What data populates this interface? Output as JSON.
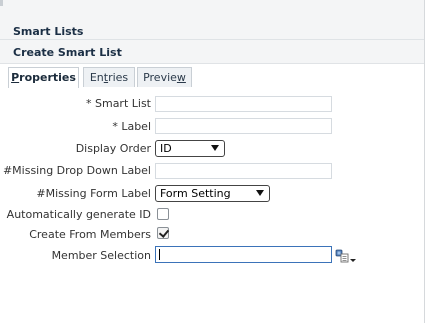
{
  "header": {
    "title": "Smart Lists",
    "subtitle": "Create Smart List"
  },
  "tabs": [
    {
      "label_prefix": "",
      "label_underline": "P",
      "label_rest": "roperties",
      "active": true
    },
    {
      "label_prefix": "En",
      "label_underline": "t",
      "label_rest": "ries",
      "active": false
    },
    {
      "label_prefix": "Previe",
      "label_underline": "w",
      "label_rest": "",
      "active": false
    }
  ],
  "form": {
    "smart_list_label": "* Smart List",
    "label_label": "* Label",
    "display_order_label": "Display Order",
    "display_order_value": "ID",
    "missing_drop_down_label": "#Missing Drop Down Label",
    "missing_form_label": "#Missing Form Label",
    "missing_form_value": "Form Setting",
    "auto_generate_label": "Automatically generate ID",
    "auto_generate_checked": false,
    "create_from_members_label": "Create From Members",
    "create_from_members_checked": true,
    "member_selection_label": "Member Selection"
  },
  "icons": {
    "member_selector": "member-selector-icon"
  }
}
